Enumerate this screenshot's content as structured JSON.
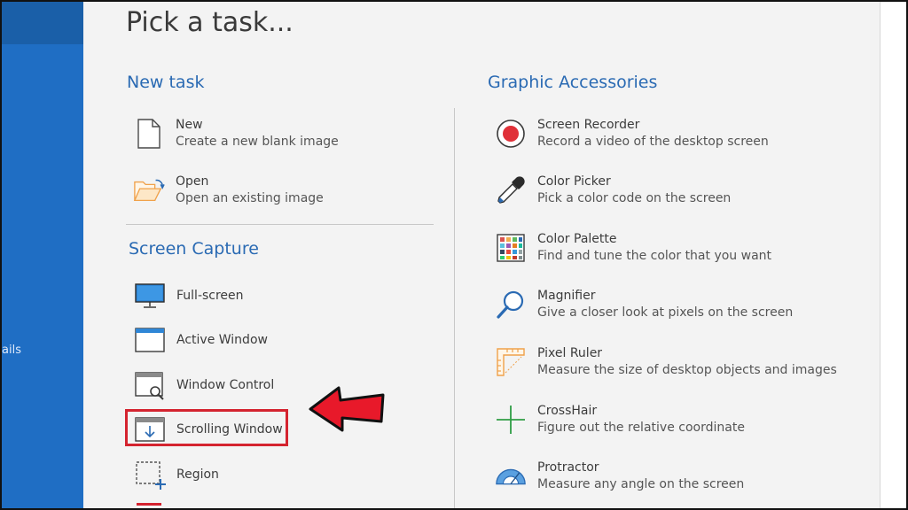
{
  "sidebar": {
    "label": "ails"
  },
  "page": {
    "title": "Pick a task..."
  },
  "sections": {
    "new_task": "New task",
    "screen_capture": "Screen Capture",
    "graphic_accessories": "Graphic Accessories"
  },
  "new_task_items": [
    {
      "title": "New",
      "desc": "Create a new blank image",
      "icon": "new-file-icon"
    },
    {
      "title": "Open",
      "desc": "Open an existing image",
      "icon": "open-folder-icon"
    }
  ],
  "capture_items": [
    {
      "label": "Full-screen",
      "icon": "monitor-icon"
    },
    {
      "label": "Active Window",
      "icon": "window-icon"
    },
    {
      "label": "Window Control",
      "icon": "window-search-icon"
    },
    {
      "label": "Scrolling Window",
      "icon": "scroll-window-icon"
    },
    {
      "label": "Region",
      "icon": "region-select-icon"
    }
  ],
  "accessory_items": [
    {
      "title": "Screen Recorder",
      "desc": "Record a video of the desktop screen",
      "icon": "record-icon"
    },
    {
      "title": "Color Picker",
      "desc": "Pick a color code on the screen",
      "icon": "eyedropper-icon"
    },
    {
      "title": "Color Palette",
      "desc": "Find and tune the color that you want",
      "icon": "palette-grid-icon"
    },
    {
      "title": "Magnifier",
      "desc": "Give a closer look at pixels on the screen",
      "icon": "magnifier-icon"
    },
    {
      "title": "Pixel Ruler",
      "desc": "Measure the size of desktop objects and images",
      "icon": "ruler-icon"
    },
    {
      "title": "CrossHair",
      "desc": "Figure out the relative coordinate",
      "icon": "crosshair-icon"
    },
    {
      "title": "Protractor",
      "desc": "Measure any angle on the screen",
      "icon": "protractor-icon"
    }
  ],
  "colors": {
    "accent": "#2a6ab3",
    "sidebar": "#1f6ec4",
    "highlight": "#d4232f"
  }
}
